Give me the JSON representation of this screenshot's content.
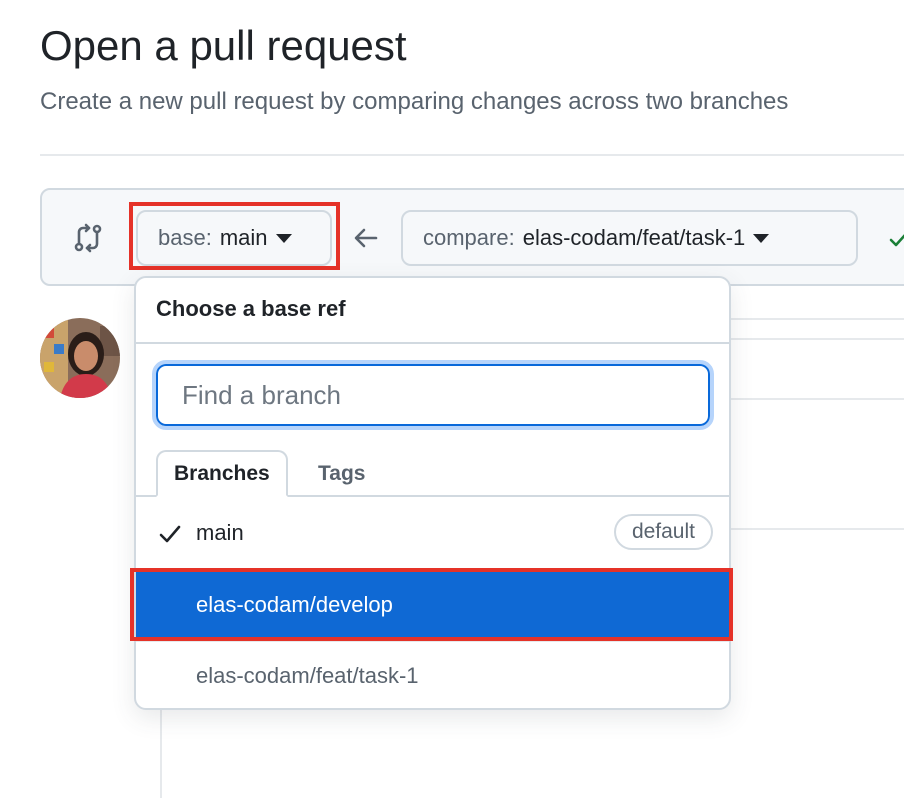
{
  "page": {
    "title": "Open a pull request",
    "subtitle": "Create a new pull request by comparing changes across two branches"
  },
  "compare_bar": {
    "base_label": "base:",
    "base_value": "main",
    "compare_label": "compare:",
    "compare_value": "elas-codam/feat/task-1",
    "icons": [
      "git-compare-icon",
      "arrow-left-icon",
      "check-icon"
    ],
    "status_color": "#1a7f37"
  },
  "dropdown": {
    "title": "Choose a base ref",
    "filter_placeholder": "Find a branch",
    "tabs": [
      {
        "label": "Branches",
        "selected": true
      },
      {
        "label": "Tags",
        "selected": false
      }
    ],
    "items": [
      {
        "label": "main",
        "checked": true,
        "badge": "default"
      },
      {
        "label": "elas-codam/develop",
        "highlighted": true
      },
      {
        "label": "elas-codam/feat/task-1"
      }
    ],
    "highlight_color": "#0f69d4"
  },
  "annotation_color": "#e53228"
}
